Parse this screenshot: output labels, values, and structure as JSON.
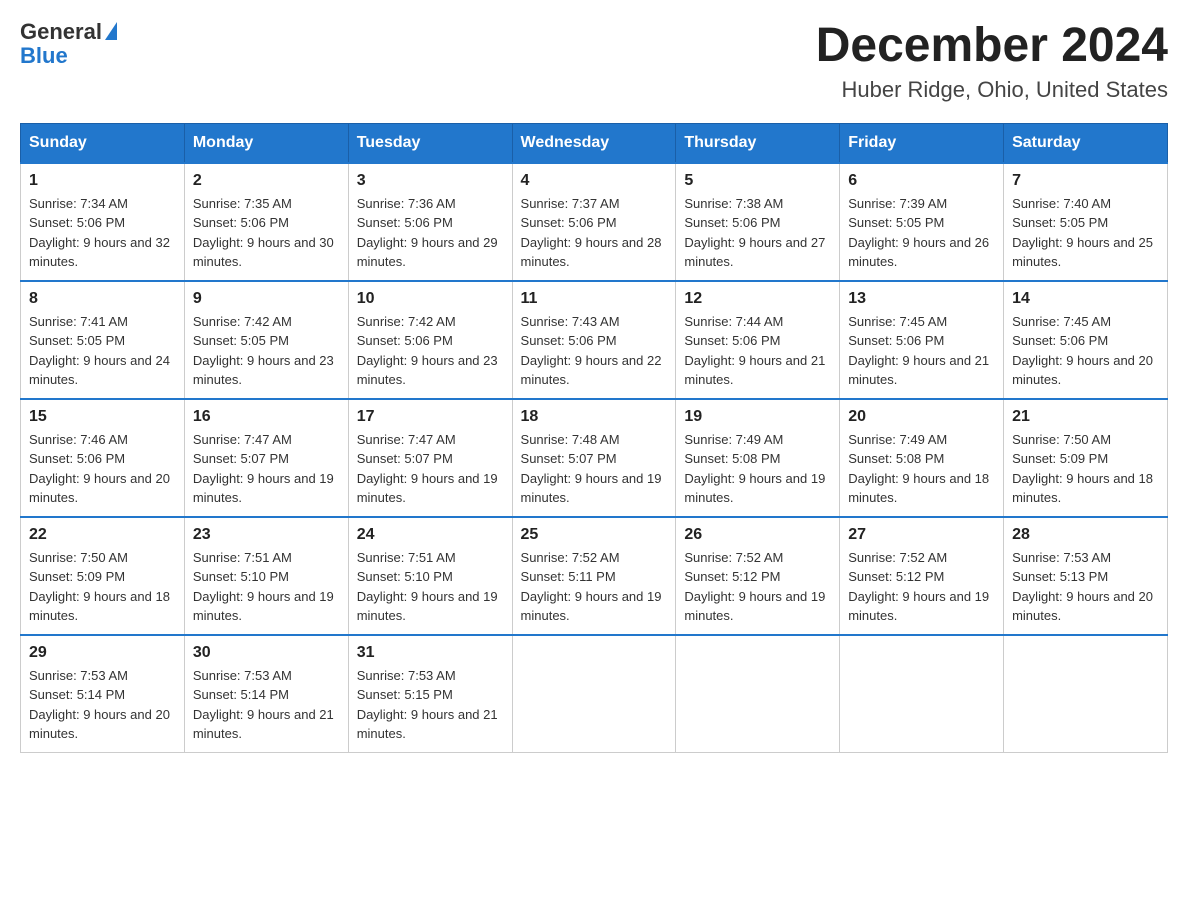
{
  "header": {
    "logo_general": "General",
    "logo_blue": "Blue",
    "month_title": "December 2024",
    "location": "Huber Ridge, Ohio, United States"
  },
  "days_of_week": [
    "Sunday",
    "Monday",
    "Tuesday",
    "Wednesday",
    "Thursday",
    "Friday",
    "Saturday"
  ],
  "weeks": [
    [
      {
        "day": "1",
        "sunrise": "Sunrise: 7:34 AM",
        "sunset": "Sunset: 5:06 PM",
        "daylight": "Daylight: 9 hours and 32 minutes."
      },
      {
        "day": "2",
        "sunrise": "Sunrise: 7:35 AM",
        "sunset": "Sunset: 5:06 PM",
        "daylight": "Daylight: 9 hours and 30 minutes."
      },
      {
        "day": "3",
        "sunrise": "Sunrise: 7:36 AM",
        "sunset": "Sunset: 5:06 PM",
        "daylight": "Daylight: 9 hours and 29 minutes."
      },
      {
        "day": "4",
        "sunrise": "Sunrise: 7:37 AM",
        "sunset": "Sunset: 5:06 PM",
        "daylight": "Daylight: 9 hours and 28 minutes."
      },
      {
        "day": "5",
        "sunrise": "Sunrise: 7:38 AM",
        "sunset": "Sunset: 5:06 PM",
        "daylight": "Daylight: 9 hours and 27 minutes."
      },
      {
        "day": "6",
        "sunrise": "Sunrise: 7:39 AM",
        "sunset": "Sunset: 5:05 PM",
        "daylight": "Daylight: 9 hours and 26 minutes."
      },
      {
        "day": "7",
        "sunrise": "Sunrise: 7:40 AM",
        "sunset": "Sunset: 5:05 PM",
        "daylight": "Daylight: 9 hours and 25 minutes."
      }
    ],
    [
      {
        "day": "8",
        "sunrise": "Sunrise: 7:41 AM",
        "sunset": "Sunset: 5:05 PM",
        "daylight": "Daylight: 9 hours and 24 minutes."
      },
      {
        "day": "9",
        "sunrise": "Sunrise: 7:42 AM",
        "sunset": "Sunset: 5:05 PM",
        "daylight": "Daylight: 9 hours and 23 minutes."
      },
      {
        "day": "10",
        "sunrise": "Sunrise: 7:42 AM",
        "sunset": "Sunset: 5:06 PM",
        "daylight": "Daylight: 9 hours and 23 minutes."
      },
      {
        "day": "11",
        "sunrise": "Sunrise: 7:43 AM",
        "sunset": "Sunset: 5:06 PM",
        "daylight": "Daylight: 9 hours and 22 minutes."
      },
      {
        "day": "12",
        "sunrise": "Sunrise: 7:44 AM",
        "sunset": "Sunset: 5:06 PM",
        "daylight": "Daylight: 9 hours and 21 minutes."
      },
      {
        "day": "13",
        "sunrise": "Sunrise: 7:45 AM",
        "sunset": "Sunset: 5:06 PM",
        "daylight": "Daylight: 9 hours and 21 minutes."
      },
      {
        "day": "14",
        "sunrise": "Sunrise: 7:45 AM",
        "sunset": "Sunset: 5:06 PM",
        "daylight": "Daylight: 9 hours and 20 minutes."
      }
    ],
    [
      {
        "day": "15",
        "sunrise": "Sunrise: 7:46 AM",
        "sunset": "Sunset: 5:06 PM",
        "daylight": "Daylight: 9 hours and 20 minutes."
      },
      {
        "day": "16",
        "sunrise": "Sunrise: 7:47 AM",
        "sunset": "Sunset: 5:07 PM",
        "daylight": "Daylight: 9 hours and 19 minutes."
      },
      {
        "day": "17",
        "sunrise": "Sunrise: 7:47 AM",
        "sunset": "Sunset: 5:07 PM",
        "daylight": "Daylight: 9 hours and 19 minutes."
      },
      {
        "day": "18",
        "sunrise": "Sunrise: 7:48 AM",
        "sunset": "Sunset: 5:07 PM",
        "daylight": "Daylight: 9 hours and 19 minutes."
      },
      {
        "day": "19",
        "sunrise": "Sunrise: 7:49 AM",
        "sunset": "Sunset: 5:08 PM",
        "daylight": "Daylight: 9 hours and 19 minutes."
      },
      {
        "day": "20",
        "sunrise": "Sunrise: 7:49 AM",
        "sunset": "Sunset: 5:08 PM",
        "daylight": "Daylight: 9 hours and 18 minutes."
      },
      {
        "day": "21",
        "sunrise": "Sunrise: 7:50 AM",
        "sunset": "Sunset: 5:09 PM",
        "daylight": "Daylight: 9 hours and 18 minutes."
      }
    ],
    [
      {
        "day": "22",
        "sunrise": "Sunrise: 7:50 AM",
        "sunset": "Sunset: 5:09 PM",
        "daylight": "Daylight: 9 hours and 18 minutes."
      },
      {
        "day": "23",
        "sunrise": "Sunrise: 7:51 AM",
        "sunset": "Sunset: 5:10 PM",
        "daylight": "Daylight: 9 hours and 19 minutes."
      },
      {
        "day": "24",
        "sunrise": "Sunrise: 7:51 AM",
        "sunset": "Sunset: 5:10 PM",
        "daylight": "Daylight: 9 hours and 19 minutes."
      },
      {
        "day": "25",
        "sunrise": "Sunrise: 7:52 AM",
        "sunset": "Sunset: 5:11 PM",
        "daylight": "Daylight: 9 hours and 19 minutes."
      },
      {
        "day": "26",
        "sunrise": "Sunrise: 7:52 AM",
        "sunset": "Sunset: 5:12 PM",
        "daylight": "Daylight: 9 hours and 19 minutes."
      },
      {
        "day": "27",
        "sunrise": "Sunrise: 7:52 AM",
        "sunset": "Sunset: 5:12 PM",
        "daylight": "Daylight: 9 hours and 19 minutes."
      },
      {
        "day": "28",
        "sunrise": "Sunrise: 7:53 AM",
        "sunset": "Sunset: 5:13 PM",
        "daylight": "Daylight: 9 hours and 20 minutes."
      }
    ],
    [
      {
        "day": "29",
        "sunrise": "Sunrise: 7:53 AM",
        "sunset": "Sunset: 5:14 PM",
        "daylight": "Daylight: 9 hours and 20 minutes."
      },
      {
        "day": "30",
        "sunrise": "Sunrise: 7:53 AM",
        "sunset": "Sunset: 5:14 PM",
        "daylight": "Daylight: 9 hours and 21 minutes."
      },
      {
        "day": "31",
        "sunrise": "Sunrise: 7:53 AM",
        "sunset": "Sunset: 5:15 PM",
        "daylight": "Daylight: 9 hours and 21 minutes."
      },
      null,
      null,
      null,
      null
    ]
  ]
}
